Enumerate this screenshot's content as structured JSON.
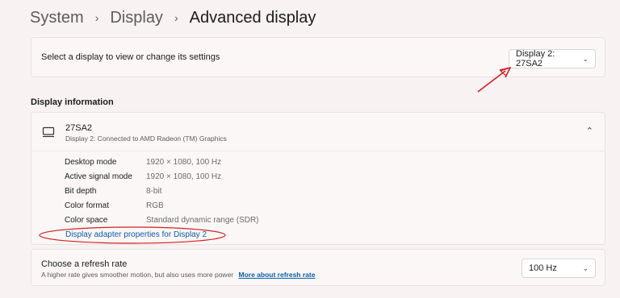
{
  "breadcrumb": {
    "items": [
      "System",
      "Display"
    ],
    "separator": "›",
    "current": "Advanced display"
  },
  "display_select": {
    "label": "Select a display to view or change its settings",
    "selected": "Display 2: 27SA2"
  },
  "display_information": {
    "section_title": "Display information",
    "monitor_name": "27SA2",
    "monitor_subtitle": "Display 2: Connected to AMD Radeon (TM) Graphics",
    "properties": [
      {
        "label": "Desktop mode",
        "value": "1920 × 1080, 100 Hz"
      },
      {
        "label": "Active signal mode",
        "value": "1920 × 1080, 100 Hz"
      },
      {
        "label": "Bit depth",
        "value": "8-bit"
      },
      {
        "label": "Color format",
        "value": "RGB"
      },
      {
        "label": "Color space",
        "value": "Standard dynamic range (SDR)"
      }
    ],
    "adapter_link": "Display adapter properties for Display 2"
  },
  "refresh_rate": {
    "title": "Choose a refresh rate",
    "description": "A higher rate gives smoother motion, but also uses more power",
    "link": "More about refresh rate",
    "selected": "100 Hz"
  },
  "colors": {
    "background": "#f8f2f2",
    "card": "#fbf7f7",
    "link": "#0a5ea8",
    "annotation": "#d42020"
  },
  "icons": [
    "chevron-right-icon",
    "chevron-down-icon",
    "chevron-up-icon",
    "monitor-icon",
    "annotation-arrow",
    "annotation-ellipse"
  ]
}
